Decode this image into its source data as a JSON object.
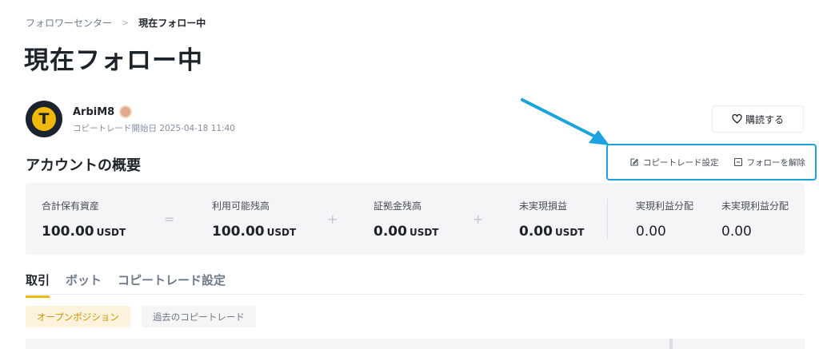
{
  "breadcrumb": {
    "parent": "フォロワーセンター",
    "separator": ">",
    "current": "現在フォロー中"
  },
  "page_title": "現在フォロー中",
  "trader": {
    "name": "ArbiM8",
    "avatar_letter": "T",
    "start_label": "コピートレード開始日 2025-04-18 11:40"
  },
  "subscribe_button": "購読する",
  "overview": {
    "title": "アカウントの概要",
    "actions": {
      "copy_settings": "コピートレード設定",
      "unfollow": "フォローを解除"
    },
    "stats": [
      {
        "label": "合計保有資産",
        "value": "100.00",
        "unit": "USDT"
      },
      {
        "label": "利用可能残高",
        "value": "100.00",
        "unit": "USDT"
      },
      {
        "label": "証拠金残高",
        "value": "0.00",
        "unit": "USDT"
      },
      {
        "label": "未実現損益",
        "value": "0.00",
        "unit": "USDT"
      }
    ],
    "operators": [
      "=",
      "+",
      "+"
    ],
    "profit_share": [
      {
        "label": "実現利益分配",
        "value": "0.00"
      },
      {
        "label": "未実現利益分配",
        "value": "0.00"
      }
    ]
  },
  "tabs": [
    {
      "label": "取引",
      "active": true
    },
    {
      "label": "ボット",
      "active": false
    },
    {
      "label": "コピートレード設定",
      "active": false
    }
  ],
  "subtabs": [
    {
      "label": "オープンポジション",
      "active": true
    },
    {
      "label": "過去のコピートレード",
      "active": false
    }
  ],
  "colors": {
    "accent": "#f0b90b",
    "highlight_box": "#1aa3df",
    "card_bg": "#f5f5f7",
    "active_subtab_bg": "#fdf3dc",
    "active_subtab_text": "#c99400"
  },
  "icons": {
    "subscribe": "heart-icon",
    "copy_settings": "edit-icon",
    "unfollow": "minus-square-icon",
    "trader_badge": "badge-icon"
  }
}
